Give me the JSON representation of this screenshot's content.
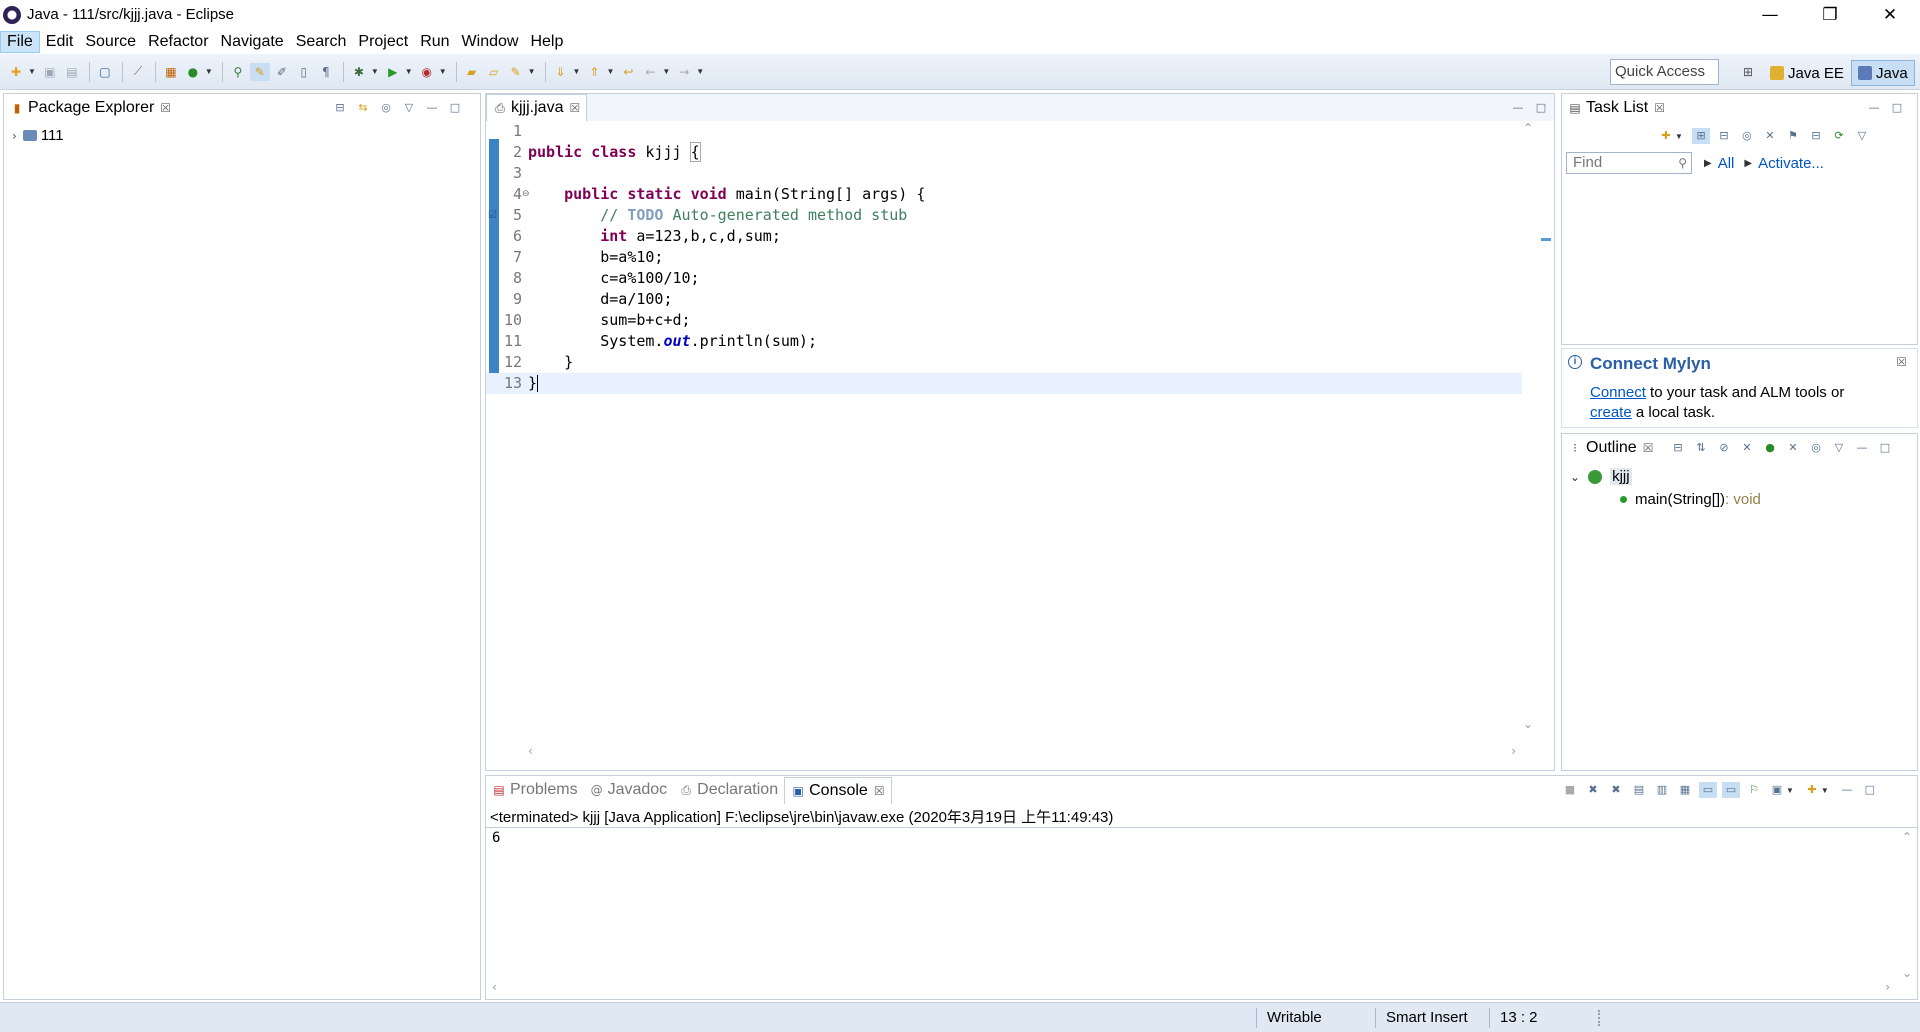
{
  "window": {
    "title": "Java - 111/src/kjjj.java - Eclipse",
    "minimize": "—",
    "restore": "❐",
    "close": "✕"
  },
  "menu": [
    "File",
    "Edit",
    "Source",
    "Refactor",
    "Navigate",
    "Search",
    "Project",
    "Run",
    "Window",
    "Help"
  ],
  "toolbar": {
    "quick_access_placeholder": "Quick Access",
    "perspectives": [
      "Java EE",
      "Java"
    ]
  },
  "package_explorer": {
    "title": "Package Explorer",
    "tree": [
      {
        "label": "111",
        "expanded": false
      }
    ]
  },
  "editor": {
    "tab_label": "kjjj.java",
    "lines": [
      "",
      "public class kjjj {",
      "",
      "    public static void main(String[] args) {",
      "        // TODO Auto-generated method stub",
      "        int a=123,b,c,d,sum;",
      "        b=a%10;",
      "        c=a%100/10;",
      "        d=a/100;",
      "        sum=b+c+d;",
      "        System.out.println(sum);",
      "    }",
      "}"
    ],
    "line_numbers": [
      "1",
      "2",
      "3",
      "4",
      "5",
      "6",
      "7",
      "8",
      "9",
      "10",
      "11",
      "12",
      "13"
    ]
  },
  "task_list": {
    "title": "Task List",
    "find_placeholder": "Find",
    "all_label": "All",
    "activate_label": "Activate..."
  },
  "mylyn": {
    "title": "Connect Mylyn",
    "link1": "Connect",
    "text1": " to your task and ALM tools or",
    "link2": "create",
    "text2": " a local task."
  },
  "outline": {
    "title": "Outline",
    "class_name": "kjjj",
    "method": "main(String[])",
    "method_type": " : void"
  },
  "bottom_panel": {
    "tabs": [
      "Problems",
      "Javadoc",
      "Declaration",
      "Console"
    ],
    "active_tab": "Console",
    "console_header": "<terminated> kjjj [Java Application] F:\\eclipse\\jre\\bin\\javaw.exe (2020年3月19日 上午11:49:43)",
    "console_output": "6"
  },
  "status": {
    "writable": "Writable",
    "insert_mode": "Smart Insert",
    "position": "13 : 2"
  },
  "colors": {
    "keyword": "#7f0055",
    "comment": "#3f7f5f",
    "field": "#0000c0",
    "link": "#0055c8"
  }
}
